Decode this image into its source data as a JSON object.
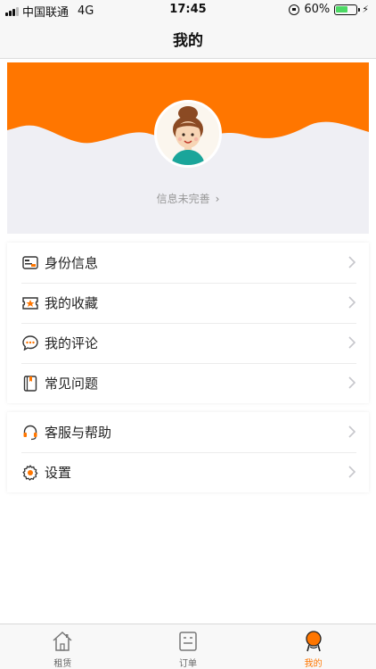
{
  "status_bar": {
    "carrier": "中国联通",
    "network": "4G",
    "time": "17:45",
    "battery_percent": "60%",
    "battery_level": 0.6
  },
  "nav": {
    "title": "我的"
  },
  "profile": {
    "status_text": "信息未完善",
    "accent_color": "#ff7600"
  },
  "menu": {
    "group1": [
      {
        "label": "身份信息",
        "icon": "id-card-icon"
      },
      {
        "label": "我的收藏",
        "icon": "favorite-ticket-icon"
      },
      {
        "label": "我的评论",
        "icon": "comment-bubble-icon"
      },
      {
        "label": "常见问题",
        "icon": "book-icon"
      }
    ],
    "group2": [
      {
        "label": "客服与帮助",
        "icon": "headset-icon"
      },
      {
        "label": "设置",
        "icon": "gear-icon"
      }
    ]
  },
  "tabs": [
    {
      "label": "租赁",
      "icon": "home-icon",
      "active": false
    },
    {
      "label": "订单",
      "icon": "order-list-icon",
      "active": false
    },
    {
      "label": "我的",
      "icon": "person-icon",
      "active": true
    }
  ]
}
